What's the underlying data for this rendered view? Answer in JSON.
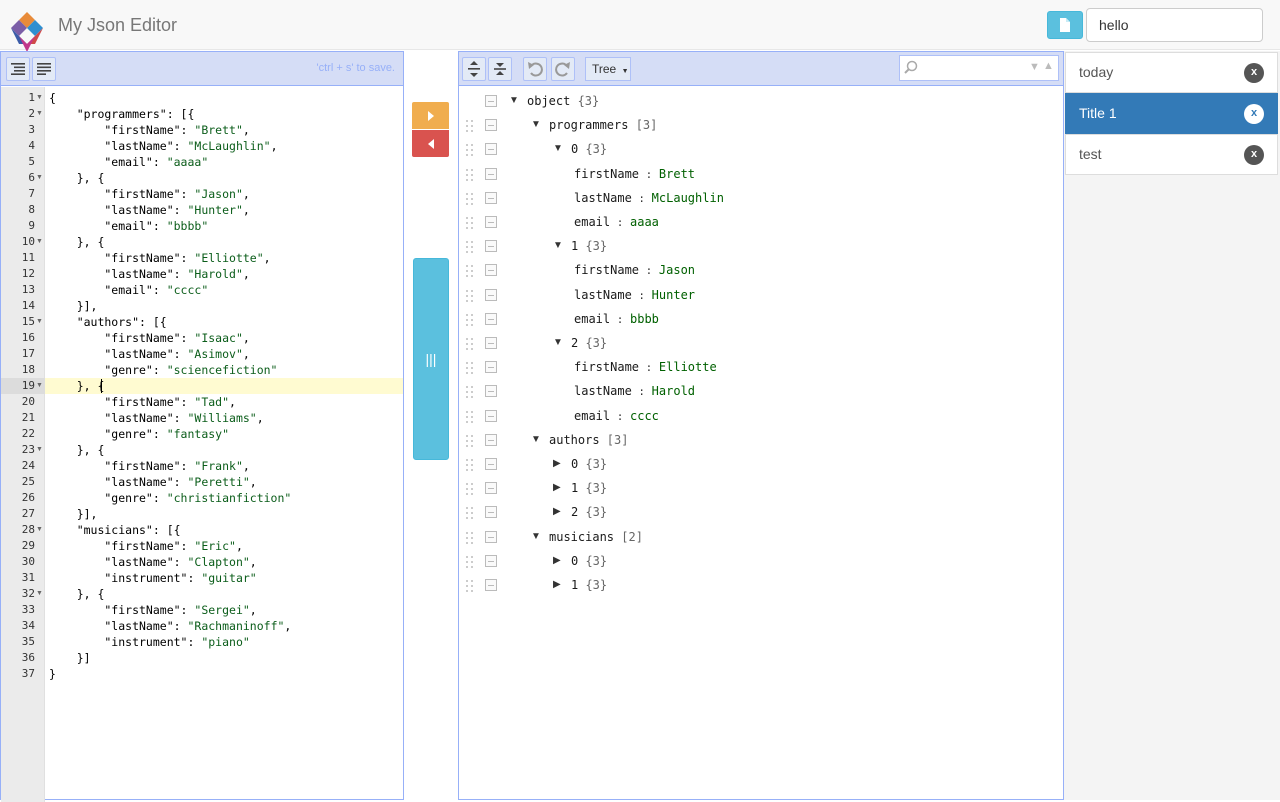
{
  "app": {
    "title": "My Json Editor"
  },
  "header": {
    "doc_name": "hello"
  },
  "code_editor": {
    "save_hint": "'ctrl + s' to save.",
    "lines": [
      "{",
      "    \"programmers\": [{",
      "        \"firstName\": \"Brett\",",
      "        \"lastName\": \"McLaughlin\",",
      "        \"email\": \"aaaa\"",
      "    }, {",
      "        \"firstName\": \"Jason\",",
      "        \"lastName\": \"Hunter\",",
      "        \"email\": \"bbbb\"",
      "    }, {",
      "        \"firstName\": \"Elliotte\",",
      "        \"lastName\": \"Harold\",",
      "        \"email\": \"cccc\"",
      "    }],",
      "    \"authors\": [{",
      "        \"firstName\": \"Isaac\",",
      "        \"lastName\": \"Asimov\",",
      "        \"genre\": \"sciencefiction\"",
      "    }, {",
      "        \"firstName\": \"Tad\",",
      "        \"lastName\": \"Williams\",",
      "        \"genre\": \"fantasy\"",
      "    }, {",
      "        \"firstName\": \"Frank\",",
      "        \"lastName\": \"Peretti\",",
      "        \"genre\": \"christianfiction\"",
      "    }],",
      "    \"musicians\": [{",
      "        \"firstName\": \"Eric\",",
      "        \"lastName\": \"Clapton\",",
      "        \"instrument\": \"guitar\"",
      "    }, {",
      "        \"firstName\": \"Sergei\",",
      "        \"lastName\": \"Rachmaninoff\",",
      "        \"instrument\": \"piano\"",
      "    }]",
      "}"
    ],
    "fold_lines": [
      1,
      2,
      6,
      10,
      15,
      19,
      23,
      28,
      32
    ],
    "active_line": 19
  },
  "tree_editor": {
    "mode_label": "Tree",
    "nodes": [
      {
        "depth": 0,
        "arrow": "down",
        "field": "object",
        "count": "{3}"
      },
      {
        "depth": 1,
        "arrow": "down",
        "field": "programmers",
        "count": "[3]"
      },
      {
        "depth": 2,
        "arrow": "down",
        "field": "0",
        "count": "{3}"
      },
      {
        "depth": 3,
        "field": "firstName",
        "value": "Brett"
      },
      {
        "depth": 3,
        "field": "lastName",
        "value": "McLaughlin"
      },
      {
        "depth": 3,
        "field": "email",
        "value": "aaaa"
      },
      {
        "depth": 2,
        "arrow": "down",
        "field": "1",
        "count": "{3}"
      },
      {
        "depth": 3,
        "field": "firstName",
        "value": "Jason"
      },
      {
        "depth": 3,
        "field": "lastName",
        "value": "Hunter"
      },
      {
        "depth": 3,
        "field": "email",
        "value": "bbbb"
      },
      {
        "depth": 2,
        "arrow": "down",
        "field": "2",
        "count": "{3}"
      },
      {
        "depth": 3,
        "field": "firstName",
        "value": "Elliotte"
      },
      {
        "depth": 3,
        "field": "lastName",
        "value": "Harold"
      },
      {
        "depth": 3,
        "field": "email",
        "value": "cccc"
      },
      {
        "depth": 1,
        "arrow": "down",
        "field": "authors",
        "count": "[3]"
      },
      {
        "depth": 2,
        "arrow": "right",
        "field": "0",
        "count": "{3}"
      },
      {
        "depth": 2,
        "arrow": "right",
        "field": "1",
        "count": "{3}"
      },
      {
        "depth": 2,
        "arrow": "right",
        "field": "2",
        "count": "{3}"
      },
      {
        "depth": 1,
        "arrow": "down",
        "field": "musicians",
        "count": "[2]"
      },
      {
        "depth": 2,
        "arrow": "right",
        "field": "0",
        "count": "{3}"
      },
      {
        "depth": 2,
        "arrow": "right",
        "field": "1",
        "count": "{3}"
      }
    ]
  },
  "documents": {
    "items": [
      {
        "label": "today",
        "active": false,
        "close_label": "x"
      },
      {
        "label": "Title 1",
        "active": true,
        "close_label": "x"
      },
      {
        "label": "test",
        "active": false,
        "close_label": "x"
      }
    ]
  },
  "splitter": {
    "grip_label": "|||"
  },
  "colors": {
    "accent": "#5bc0de",
    "active_item": "#337ab7",
    "copy_right": "#f0ad4e",
    "copy_left": "#d9534f",
    "panel_border": "#97b0f8"
  }
}
